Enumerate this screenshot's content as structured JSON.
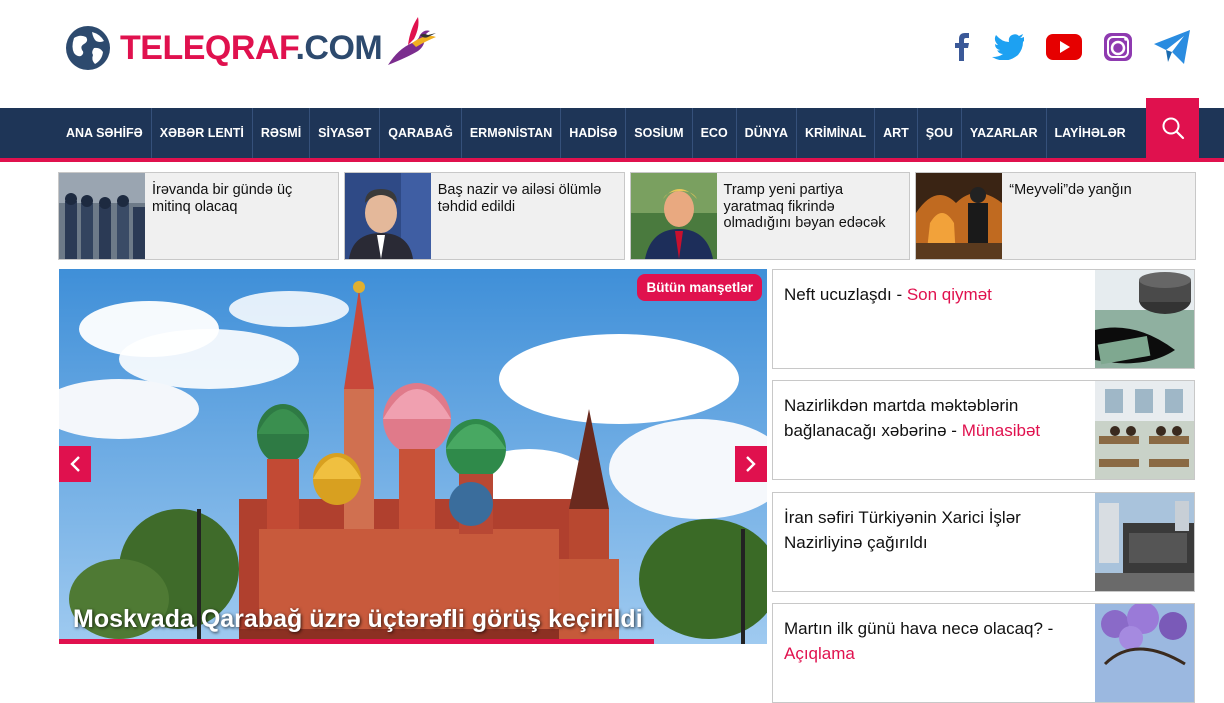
{
  "brand": {
    "tele": "TELEQRAF",
    "com": ".COM"
  },
  "social": [
    "facebook-icon",
    "twitter-icon",
    "youtube-icon",
    "instagram-icon",
    "telegram-icon"
  ],
  "nav": {
    "items": [
      "ANA SƏHİFƏ",
      "XƏBƏR LENTİ",
      "RƏSMİ",
      "SİYASƏT",
      "QARABAĞ",
      "ERMƏNİSTAN",
      "HADİSƏ",
      "SOSİUM",
      "ECO",
      "DÜNYA",
      "KRİMİNAL",
      "ART",
      "ŞOU",
      "YAZARLAR",
      "LAYİHƏLƏR"
    ],
    "search_icon": "search-icon"
  },
  "strip": [
    {
      "title": "İrəvanda bir gündə üç mitinq olacaq"
    },
    {
      "title": "Baş nazir və ailəsi ölümlə təhdid edildi"
    },
    {
      "title": "Tramp yeni partiya yaratmaq fikrində olmadığını bəyan edəcək"
    },
    {
      "title": "“Meyvəli”də yanğın"
    }
  ],
  "slider": {
    "title": "Moskvada Qarabağ üzrə üçtərəfli görüş keçirildi",
    "all_headlines": "Bütün manşetlər"
  },
  "right_news": [
    {
      "title": "Neft ucuzlaşdı - ",
      "highlight": "Son qiymət"
    },
    {
      "title": "Nazirlikdən martda məktəblərin bağlanacağı xəbərinə - ",
      "highlight": "Münasibət"
    },
    {
      "title": "İran səfiri Türkiyənin Xarici İşlər Nazirliyinə çağırıldı",
      "highlight": ""
    },
    {
      "title": "Martın ilk günü hava necə olacaq? - ",
      "highlight": "Açıqlama"
    }
  ],
  "colors": {
    "accent": "#e0114e",
    "nav_bg": "#1e3557"
  }
}
